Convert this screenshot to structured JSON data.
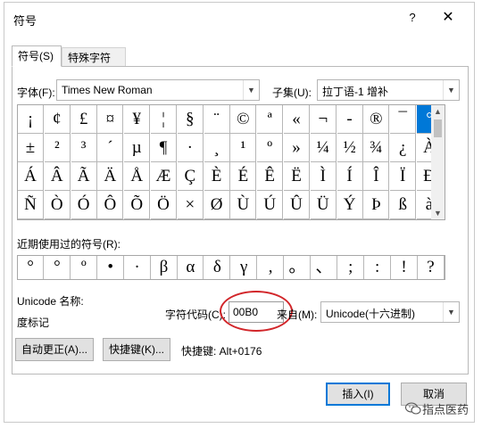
{
  "window": {
    "title": "符号",
    "help_label": "?",
    "close_label": "✕"
  },
  "tabs": [
    {
      "label": "符号(S)",
      "active": true
    },
    {
      "label": "特殊字符(P)",
      "active": false
    }
  ],
  "font": {
    "label": "字体(F):",
    "value": "Times New Roman"
  },
  "subset": {
    "label": "子集(U):",
    "value": "拉丁语-1 增补"
  },
  "symbols": {
    "rows": [
      [
        "¡",
        "¢",
        "£",
        "¤",
        "¥",
        "¦",
        "§",
        "¨",
        "©",
        "ª",
        "«",
        "¬",
        "-",
        "®",
        "¯",
        "°"
      ],
      [
        "±",
        "²",
        "³",
        "´",
        "µ",
        "¶",
        "·",
        "¸",
        "¹",
        "º",
        "»",
        "¼",
        "½",
        "¾",
        "¿",
        "À"
      ],
      [
        "Á",
        "Â",
        "Ã",
        "Ä",
        "Å",
        "Æ",
        "Ç",
        "È",
        "É",
        "Ê",
        "Ë",
        "Ì",
        "Í",
        "Î",
        "Ï",
        "Ð"
      ],
      [
        "Ñ",
        "Ò",
        "Ó",
        "Ô",
        "Õ",
        "Ö",
        "×",
        "Ø",
        "Ù",
        "Ú",
        "Û",
        "Ü",
        "Ý",
        "Þ",
        "ß",
        "à"
      ]
    ],
    "selected": "°"
  },
  "recent": {
    "label": "近期使用过的符号(R):",
    "items": [
      "°",
      "°",
      "º",
      "•",
      "·",
      "β",
      "α",
      "δ",
      "γ",
      ",",
      "。",
      "、",
      ";",
      ":",
      "!",
      "?"
    ]
  },
  "unicode_name": {
    "label": "Unicode 名称:",
    "value": "度标记"
  },
  "char_code": {
    "label": "字符代码(C):",
    "value": "00B0"
  },
  "from": {
    "label": "来自(M):",
    "value": "Unicode(十六进制)"
  },
  "buttons": {
    "autocorrect": "自动更正(A)...",
    "shortcut_key": "快捷键(K)...",
    "insert": "插入(I)",
    "cancel": "取消"
  },
  "shortcut_text": "快捷键: Alt+0176",
  "watermark": "指点医药",
  "colors": {
    "selection": "#0078d7",
    "highlight_ellipse": "#d2262a"
  }
}
